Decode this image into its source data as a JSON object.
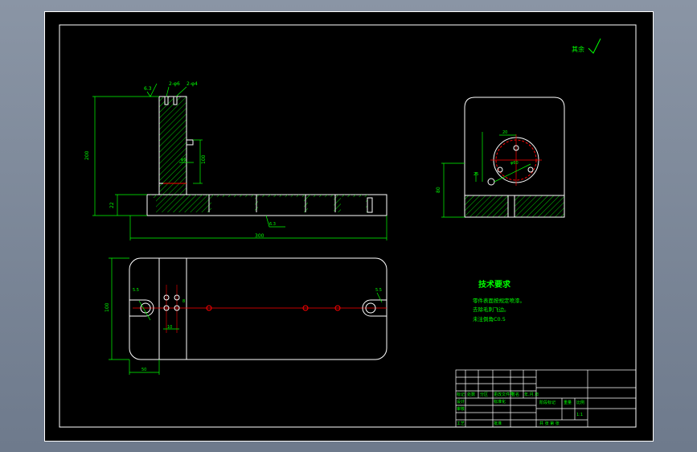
{
  "drawing": {
    "roughness_note": "其余",
    "tech_title": "技术要求",
    "tech_items": [
      "零件表面按规定喷漆。",
      "去除毛刺飞边。",
      "未注倒角C0.5"
    ],
    "front_view": {
      "top_notes": [
        "2-φ6",
        "2-φ4"
      ],
      "side_note": "6.3",
      "dim_height": "200",
      "dim_thickness": "22",
      "dim_length": "300",
      "dim_inner": "100",
      "dim_small": "φ6",
      "roughness_bottom": "6.3"
    },
    "side_view": {
      "dim_circle_top": "20",
      "dim_circle_dia": "φ60",
      "dim_height": "80",
      "dim_small": "25"
    },
    "top_view": {
      "dim_width": "100",
      "dim_offset": "50",
      "dim_hole": "5.5",
      "dim_hole_right": "5.5",
      "dim_bottom": "10",
      "dim_inner_small": "8"
    }
  },
  "title_block": {
    "header_row": [
      "标记",
      "处数",
      "分区",
      "更改文件号",
      "签名",
      "年.月.日"
    ],
    "roles": [
      "设计",
      "审核",
      "工艺"
    ],
    "std": "标准化",
    "approve": "批准",
    "stage_label": "阶段标记",
    "weight_label": "重量",
    "scale_label": "比例",
    "scale_value": "1:1",
    "sheet_label": "共  张  第  张"
  },
  "colors": {
    "outline": "#ffffff",
    "dim": "#00ff00",
    "center": "#ff0000",
    "hatch": "#00cc00"
  }
}
